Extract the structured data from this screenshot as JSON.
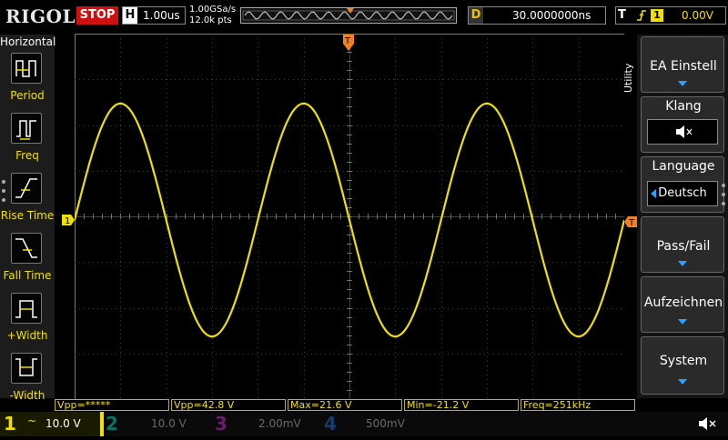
{
  "topbar": {
    "logo": "RIGOL",
    "run_state": "STOP",
    "timebase_key": "H",
    "timebase": "1.00us",
    "sample_rate": "1.00GSa/s",
    "memory_depth": "12.0k pts",
    "delay_key": "D",
    "delay": "30.0000000ns",
    "trigger_key": "T",
    "trigger_channel": "1",
    "trigger_level": "0.00V",
    "trigger_edge": "rising"
  },
  "left_menu": {
    "title": "Horizontal",
    "items": [
      {
        "label": "Period",
        "icon": "period-icon"
      },
      {
        "label": "Freq",
        "icon": "frequency-icon"
      },
      {
        "label": "Rise Time",
        "icon": "rise-time-icon"
      },
      {
        "label": "Fall Time",
        "icon": "fall-time-icon"
      },
      {
        "label": "+Width",
        "icon": "positive-width-icon"
      },
      {
        "label": "-Width",
        "icon": "negative-width-icon"
      }
    ]
  },
  "right_menu": {
    "title": "Utility",
    "items": [
      {
        "label": "EA Einstell",
        "control": "arrow"
      },
      {
        "label": "Klang",
        "control": "speaker-mute"
      },
      {
        "label": "Language",
        "value": "Deutsch"
      },
      {
        "label": "Pass/Fail",
        "control": "arrow"
      },
      {
        "label": "Aufzeichnen",
        "control": "arrow"
      },
      {
        "label": "System",
        "control": "arrow"
      }
    ]
  },
  "waveform": {
    "channel_marker": "1",
    "trigger_marker": "T",
    "color": "#f0e000",
    "cycles": 3,
    "amplitude_divs": 2.55
  },
  "measurements": [
    {
      "text": "Vpp=*****"
    },
    {
      "text": "Vpp=42.8 V"
    },
    {
      "text": "Max=21.6 V"
    },
    {
      "text": "Min=-21.2 V"
    },
    {
      "text": "Freq=251kHz"
    }
  ],
  "channels": [
    {
      "num": "1",
      "coupling": "~",
      "scale": "10.0 V",
      "active": true
    },
    {
      "num": "2",
      "scale": "10.0 V",
      "active": false
    },
    {
      "num": "3",
      "scale": "2.00mV",
      "active": false
    },
    {
      "num": "4",
      "scale": "500mV",
      "active": false
    }
  ],
  "colors": {
    "ch1": "#f0e000",
    "stop": "#d01010",
    "accent": "#29a3ff",
    "trigger_marker": "#f08020"
  }
}
